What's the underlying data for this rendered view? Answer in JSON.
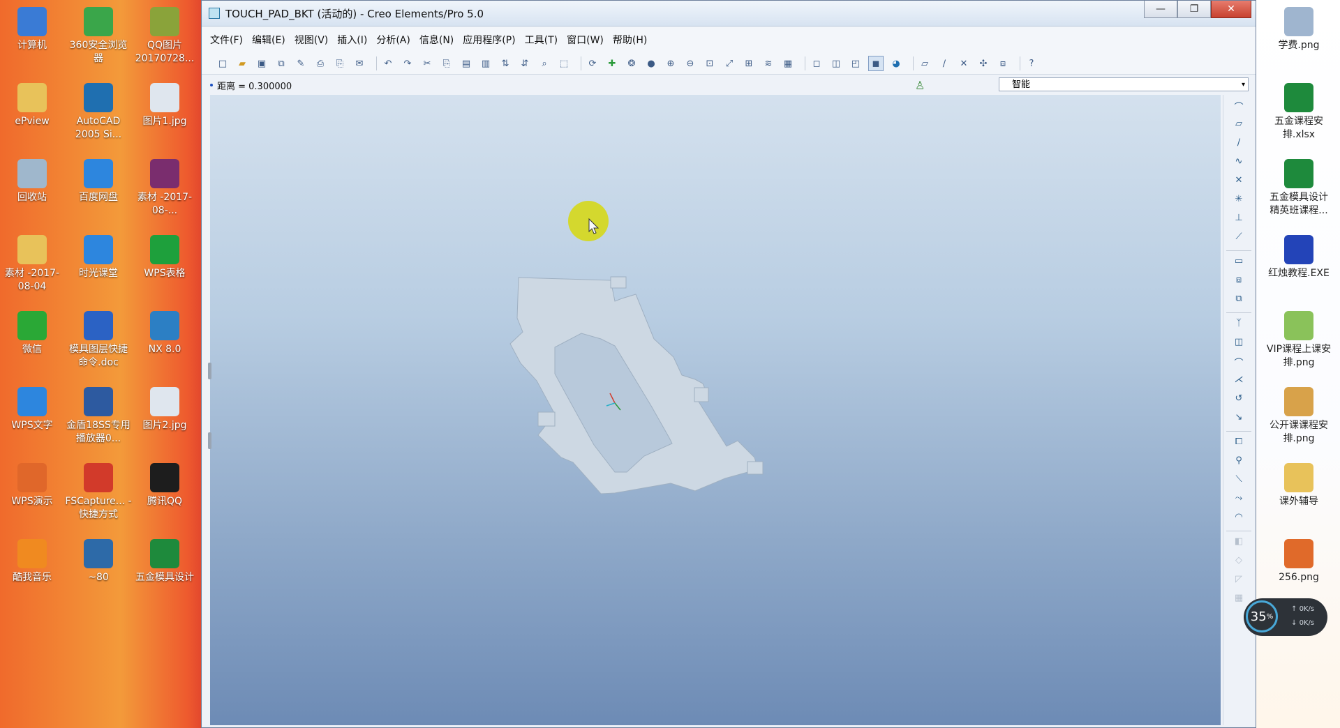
{
  "window": {
    "title": "TOUCH_PAD_BKT (活动的) - Creo Elements/Pro 5.0",
    "buttons": {
      "minimize": "—",
      "restore": "❐",
      "close": "✕"
    }
  },
  "menu": [
    "文件(F)",
    "编辑(E)",
    "视图(V)",
    "插入(I)",
    "分析(A)",
    "信息(N)",
    "应用程序(P)",
    "工具(T)",
    "窗口(W)",
    "帮助(H)"
  ],
  "infobar": {
    "distance": "距离 = 0.300000",
    "filter": "智能"
  },
  "speed": {
    "percent": "35",
    "unit": "%",
    "up": "0K/s",
    "down": "0K/s"
  },
  "desktop_left": [
    {
      "label": "计算机",
      "icon": "computer-icon",
      "color": "#3a7bd5"
    },
    {
      "label": "360安全浏览器",
      "icon": "browser-360-icon",
      "color": "#3aa64a"
    },
    {
      "label": "QQ图片20170728...",
      "icon": "image-file-icon",
      "color": "#8aa33a"
    },
    {
      "label": "ePview",
      "icon": "folder-icon",
      "color": "#e8c25a"
    },
    {
      "label": "AutoCAD 2005 Si...",
      "icon": "autocad-icon",
      "color": "#1f6fb0"
    },
    {
      "label": "图片1.jpg",
      "icon": "image-file-icon",
      "color": "#dfe6ee"
    },
    {
      "label": "回收站",
      "icon": "recycle-bin-icon",
      "color": "#9fb7cc"
    },
    {
      "label": "百度网盘",
      "icon": "baidu-netdisk-icon",
      "color": "#2d86de"
    },
    {
      "label": "素材 -2017-08-...",
      "icon": "archive-icon",
      "color": "#7a2d6e"
    },
    {
      "label": "素材 -2017-08-04",
      "icon": "folder-icon",
      "color": "#e8c25a"
    },
    {
      "label": "时光课堂",
      "icon": "classroom-icon",
      "color": "#2d86de"
    },
    {
      "label": "WPS表格",
      "icon": "wps-sheet-icon",
      "color": "#1ea03c"
    },
    {
      "label": "微信",
      "icon": "wechat-icon",
      "color": "#2aa836"
    },
    {
      "label": "模具图层快捷命令.doc",
      "icon": "doc-file-icon",
      "color": "#2b62c4"
    },
    {
      "label": "NX 8.0",
      "icon": "nx-icon",
      "color": "#2c7fc4"
    },
    {
      "label": "WPS文字",
      "icon": "wps-writer-icon",
      "color": "#2d86de"
    },
    {
      "label": "金盾18SS专用播放器0...",
      "icon": "player-icon",
      "color": "#2d5aa0"
    },
    {
      "label": "图片2.jpg",
      "icon": "image-file-icon",
      "color": "#dfe6ee"
    },
    {
      "label": "WPS演示",
      "icon": "wps-presentation-icon",
      "color": "#e0672a"
    },
    {
      "label": "FSCapture... - 快捷方式",
      "icon": "fscapture-icon",
      "color": "#d23a2a"
    },
    {
      "label": "腾讯QQ",
      "icon": "qq-icon",
      "color": "#1d1d1d"
    },
    {
      "label": "酷我音乐",
      "icon": "kuwo-music-icon",
      "color": "#f08a20"
    },
    {
      "label": "~80",
      "icon": "shortcut-icon",
      "color": "#2d6aa8"
    },
    {
      "label": "五金模具设计",
      "icon": "xlsx-file-icon",
      "color": "#1e8a3c"
    }
  ],
  "desktop_right": [
    {
      "label": "学费.png",
      "icon": "image-file-icon",
      "color": "#9fb5cf"
    },
    {
      "label": "五金课程安排.xlsx",
      "icon": "xlsx-file-icon",
      "color": "#1e8a3c"
    },
    {
      "label": "五金模具设计精英班课程...",
      "icon": "xlsx-file-icon",
      "color": "#1e8a3c"
    },
    {
      "label": "红烛教程.EXE",
      "icon": "exe-icon",
      "color": "#2344b8"
    },
    {
      "label": "VIP课程上课安排.png",
      "icon": "image-file-icon",
      "color": "#8ac25a"
    },
    {
      "label": "公开课课程安排.png",
      "icon": "image-file-icon",
      "color": "#d8a24a"
    },
    {
      "label": "课外辅导",
      "icon": "folder-icon",
      "color": "#e8c25a"
    },
    {
      "label": "256.png",
      "icon": "image-file-icon",
      "color": "#e06a2a"
    }
  ]
}
